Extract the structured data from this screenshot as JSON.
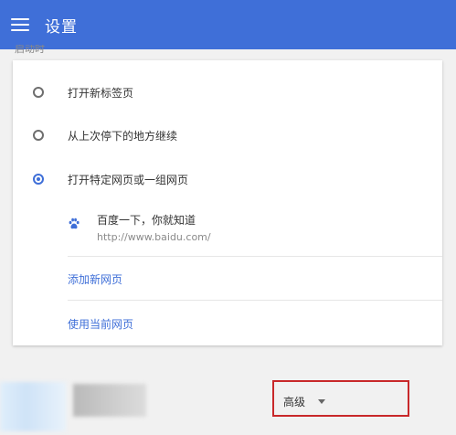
{
  "header": {
    "title": "设置"
  },
  "section": {
    "label": "启动时"
  },
  "startup": {
    "options": [
      {
        "label": "打开新标签页",
        "selected": false
      },
      {
        "label": "从上次停下的地方继续",
        "selected": false
      },
      {
        "label": "打开特定网页或一组网页",
        "selected": true
      }
    ],
    "site": {
      "title": "百度一下，你就知道",
      "url": "http://www.baidu.com/",
      "icon": "baidu-paw-icon"
    },
    "add_page": "添加新网页",
    "use_current": "使用当前网页"
  },
  "advanced": {
    "label": "高级"
  },
  "colors": {
    "accent": "#3f6fd8",
    "highlight_box": "#c8282a"
  }
}
